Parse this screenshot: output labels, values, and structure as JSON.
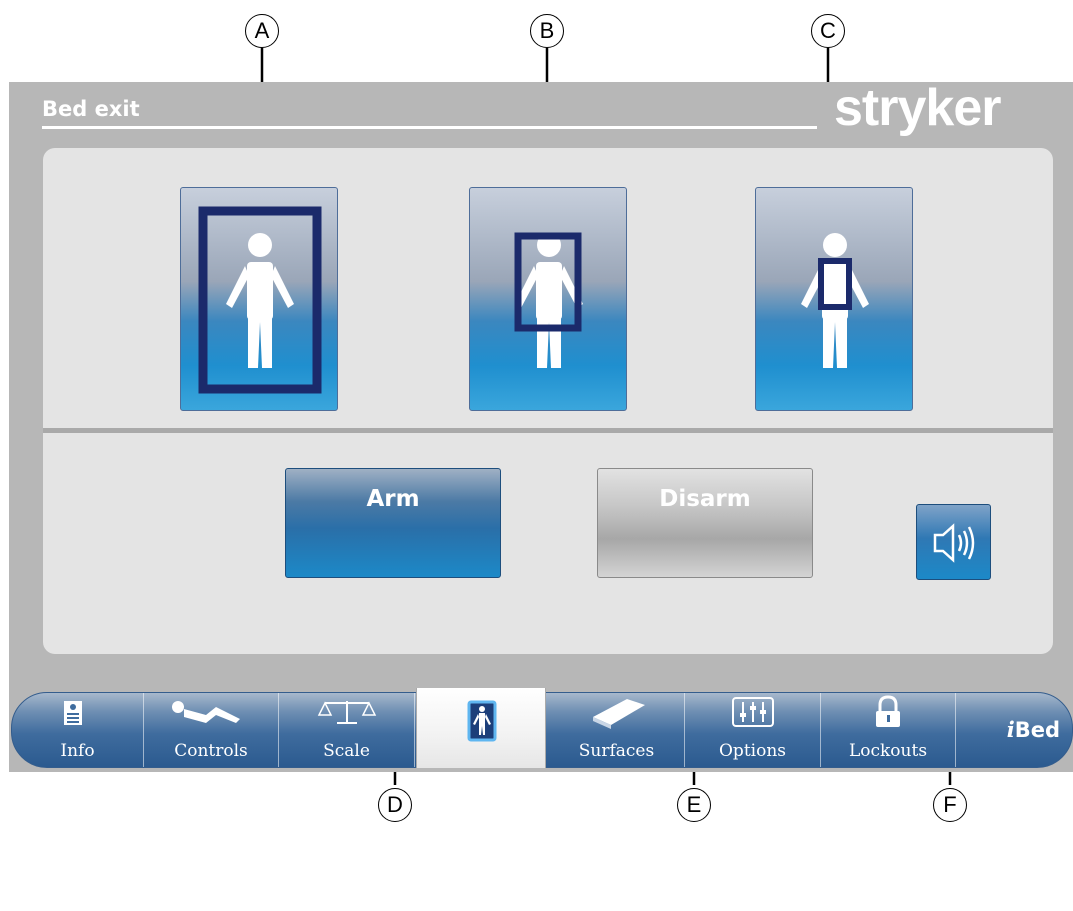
{
  "callouts": {
    "a": "A",
    "b": "B",
    "c": "C",
    "d": "D",
    "e": "E",
    "f": "F"
  },
  "header": {
    "title": "Bed exit",
    "brand": "stryker"
  },
  "zones": [
    {
      "name": "zone-1-whole-body"
    },
    {
      "name": "zone-2-torso"
    },
    {
      "name": "zone-3-center"
    }
  ],
  "controls": {
    "arm_label": "Arm",
    "disarm_label": "Disarm",
    "sound_icon": "speaker-icon"
  },
  "nav": {
    "items": [
      {
        "label": "Info",
        "icon": "info-card-icon"
      },
      {
        "label": "Controls",
        "icon": "patient-positions-icon"
      },
      {
        "label": "Scale",
        "icon": "scale-icon"
      },
      {
        "label": "",
        "icon": "bed-exit-icon",
        "active": true
      },
      {
        "label": "Surfaces",
        "icon": "surface-pad-icon"
      },
      {
        "label": "Options",
        "icon": "sliders-icon"
      },
      {
        "label": "Lockouts",
        "icon": "lock-icon"
      },
      {
        "label": "Bed",
        "prefix": "i",
        "icon": "ibed-logo"
      }
    ]
  },
  "colors": {
    "accent": "#1c89c8",
    "frame": "#1b2a6b",
    "screen_bg": "#b7b7b7",
    "panel_bg": "#e4e4e4"
  }
}
